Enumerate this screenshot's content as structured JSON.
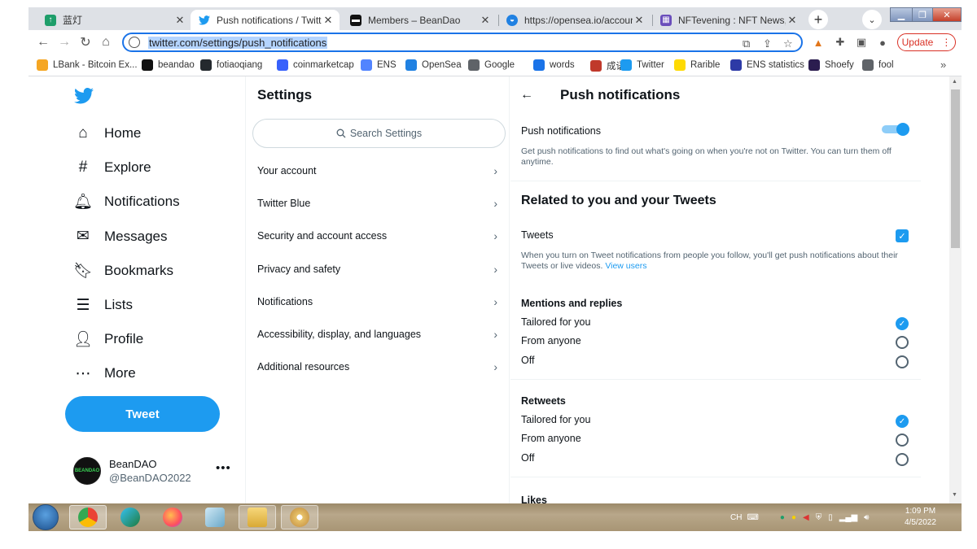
{
  "browser": {
    "tabs": [
      {
        "title": "蓝灯",
        "favicon": "lantern-icon",
        "color": "#1e9e6a"
      },
      {
        "title": "Push notifications / Twitter",
        "favicon": "twitter-icon",
        "color": "#1d9bf0",
        "active": true
      },
      {
        "title": "Members – BeanDao",
        "favicon": "beandao-icon",
        "color": "#111111"
      },
      {
        "title": "https://opensea.io/account",
        "favicon": "opensea-icon",
        "color": "#2081e2"
      },
      {
        "title": "NFTevening : NFT News, Cry",
        "favicon": "nftevening-icon",
        "color": "#6b4fbb"
      }
    ],
    "url": "twitter.com/settings/push_notifications",
    "update_label": "Update",
    "bookmarks": [
      {
        "label": "LBank - Bitcoin Ex...",
        "icon": "lbank-icon",
        "color": "#f5a623"
      },
      {
        "label": "beandao",
        "icon": "beandao-icon",
        "color": "#111111"
      },
      {
        "label": "fotiaoqiang",
        "icon": "github-icon",
        "color": "#24292e"
      },
      {
        "label": "coinmarketcap",
        "icon": "coinmarketcap-icon",
        "color": "#3861fb"
      },
      {
        "label": "ENS",
        "icon": "ens-icon",
        "color": "#5284ff"
      },
      {
        "label": "OpenSea",
        "icon": "opensea-icon",
        "color": "#2081e2"
      },
      {
        "label": "Google",
        "icon": "globe-icon",
        "color": "#5f6368"
      },
      {
        "label": "words",
        "icon": "words-icon",
        "color": "#1a73e8"
      },
      {
        "label": "成语",
        "icon": "chengyu-icon",
        "color": "#c0392b"
      },
      {
        "label": "Twitter",
        "icon": "twitter-icon",
        "color": "#1d9bf0"
      },
      {
        "label": "Rarible",
        "icon": "rarible-icon",
        "color": "#feda03"
      },
      {
        "label": "ENS statistics",
        "icon": "ens-statistics-icon",
        "color": "#2d3aa6"
      },
      {
        "label": "Shoefy",
        "icon": "shoefy-icon",
        "color": "#2b1d4f"
      },
      {
        "label": "fool",
        "icon": "globe-icon",
        "color": "#5f6368"
      }
    ]
  },
  "twitter": {
    "nav": [
      {
        "label": "Home",
        "icon": "home-icon",
        "glyph": "⌂"
      },
      {
        "label": "Explore",
        "icon": "hashtag-icon",
        "glyph": "#"
      },
      {
        "label": "Notifications",
        "icon": "bell-icon",
        "glyph": "🔔︎"
      },
      {
        "label": "Messages",
        "icon": "envelope-icon",
        "glyph": "✉"
      },
      {
        "label": "Bookmarks",
        "icon": "bookmark-icon",
        "glyph": "🔖︎"
      },
      {
        "label": "Lists",
        "icon": "list-icon",
        "glyph": "☰"
      },
      {
        "label": "Profile",
        "icon": "person-icon",
        "glyph": "👤︎"
      },
      {
        "label": "More",
        "icon": "more-circle-icon",
        "glyph": "⋯"
      }
    ],
    "tweet_label": "Tweet",
    "account": {
      "name": "BeanDAO",
      "handle": "@BeanDAO2022",
      "avatar_text": "BEANDAO"
    },
    "settings": {
      "title": "Settings",
      "search_placeholder": "Search Settings",
      "items": [
        "Your account",
        "Twitter Blue",
        "Security and account access",
        "Privacy and safety",
        "Notifications",
        "Accessibility, display, and languages",
        "Additional resources"
      ]
    },
    "push": {
      "title": "Push notifications",
      "toggle_label": "Push notifications",
      "toggle_on": true,
      "toggle_desc": "Get push notifications to find out what's going on when you're not on Twitter. You can turn them off anytime.",
      "section_title": "Related to you and your Tweets",
      "tweets_label": "Tweets",
      "tweets_checked": true,
      "tweets_desc": "When you turn on Tweet notifications from people you follow, you'll get push notifications about their Tweets or live videos.",
      "view_users": "View users",
      "groups": [
        {
          "title": "Mentions and replies",
          "options": [
            "Tailored for you",
            "From anyone",
            "Off"
          ],
          "selected": 0
        },
        {
          "title": "Retweets",
          "options": [
            "Tailored for you",
            "From anyone",
            "Off"
          ],
          "selected": 0
        }
      ],
      "next_section": "Likes"
    }
  },
  "taskbar": {
    "lang": "CH",
    "time": "1:09 PM",
    "date": "4/5/2022"
  }
}
